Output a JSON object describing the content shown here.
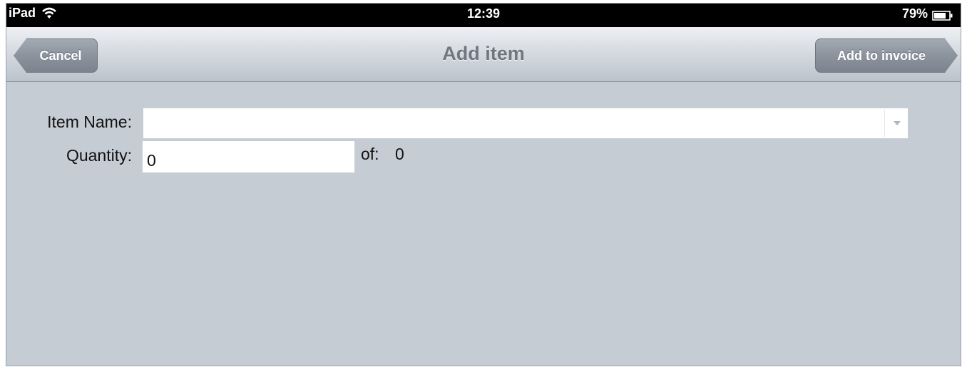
{
  "status_bar": {
    "device": "iPad",
    "time": "12:39",
    "battery": "79%",
    "icons": [
      "wifi-icon",
      "battery-icon"
    ]
  },
  "nav": {
    "title": "Add item",
    "cancel_label": "Cancel",
    "add_label": "Add to invoice"
  },
  "form": {
    "item_name_label": "Item Name:",
    "item_name_value": "",
    "quantity_label": "Quantity:",
    "quantity_value": "0",
    "of_label": "of:",
    "of_value": "0"
  },
  "colors": {
    "background": "#c5ccd4",
    "nav_title": "#6e7781",
    "button_fill": "#8b939d",
    "status_bar": "#000000"
  }
}
